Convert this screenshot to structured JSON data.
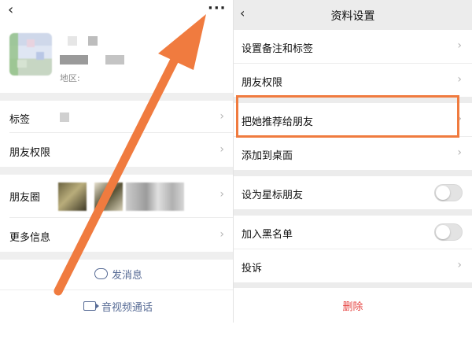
{
  "left": {
    "header": {
      "back_icon": "back-chevron-icon",
      "more_icon": "more-dots-icon",
      "more_text": "···"
    },
    "profile": {
      "region_label": "地区:"
    },
    "rows": [
      {
        "label": "标签"
      },
      {
        "label": "朋友权限"
      },
      {
        "label": "朋友圈"
      },
      {
        "label": "更多信息"
      }
    ],
    "actions": {
      "message": "发消息",
      "video_call": "音视频通话"
    }
  },
  "right": {
    "title": "资料设置",
    "rows": [
      {
        "label": "设置备注和标签"
      },
      {
        "label": "朋友权限"
      },
      {
        "label": "把她推荐给朋友"
      },
      {
        "label": "添加到桌面"
      },
      {
        "label": "设为星标朋友"
      },
      {
        "label": "加入黑名单"
      },
      {
        "label": "投诉"
      }
    ],
    "delete_label": "删除",
    "toggles": {
      "star_friend": false,
      "blacklist": false
    }
  },
  "colors": {
    "annotation_orange": "#f07b3f",
    "link_blue": "#576b95",
    "delete_red": "#e64340"
  },
  "chevron": "›",
  "back": "‹"
}
